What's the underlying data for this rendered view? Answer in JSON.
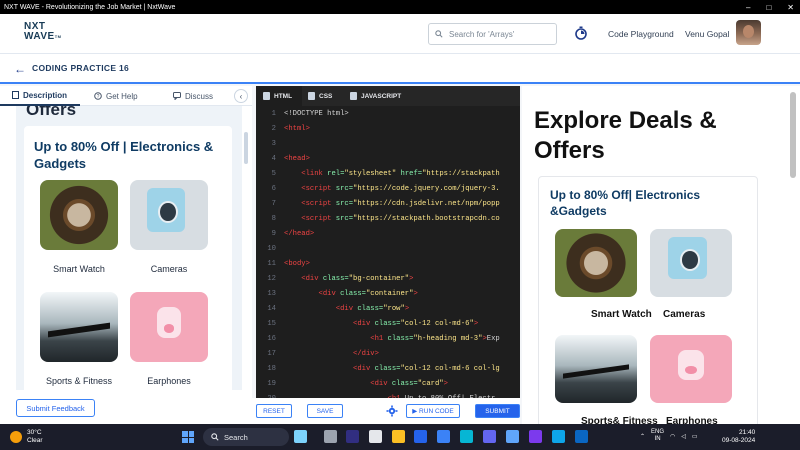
{
  "window": {
    "title": "NXT WAVE - Revolutionizing the Job Market | NxtWave",
    "controls": [
      "–",
      "□",
      "✕"
    ]
  },
  "header": {
    "logo_line1": "NXT",
    "logo_line2": "WAVE",
    "logo_tm": "TM",
    "search_placeholder": "Search for 'Arrays'",
    "playground_label": "Code Playground",
    "user_name": "Venu Gopal"
  },
  "subheader": {
    "back_icon": "←",
    "title": "CODING PRACTICE 16"
  },
  "left_panel": {
    "tabs": [
      {
        "label": "Description",
        "icon": "doc-icon"
      },
      {
        "label": "Get Help",
        "icon": "help-icon"
      },
      {
        "label": "Discuss",
        "icon": "chat-icon"
      }
    ],
    "collapse_icon": "‹",
    "preview": {
      "heading_cut": "Offers",
      "card_title": "Up to 80% Off | Electronics & Gadgets",
      "items": [
        {
          "label": "Smart Watch"
        },
        {
          "label": "Cameras"
        },
        {
          "label": "Sports & Fitness"
        },
        {
          "label": "Earphones"
        }
      ]
    },
    "feedback_button": "Submit Feedback"
  },
  "editor": {
    "tabs": [
      {
        "label": "HTML",
        "active": true
      },
      {
        "label": "CSS",
        "active": false
      },
      {
        "label": "JAVASCRIPT",
        "active": false
      }
    ],
    "lines": [
      {
        "n": "1",
        "parts": [
          [
            "p",
            "<!DOCTYPE html>"
          ]
        ]
      },
      {
        "n": "2",
        "parts": [
          [
            "t",
            "<html>"
          ]
        ]
      },
      {
        "n": "3",
        "parts": []
      },
      {
        "n": "4",
        "parts": [
          [
            "t",
            "<head>"
          ]
        ]
      },
      {
        "n": "5",
        "parts": [
          [
            "p",
            "    "
          ],
          [
            "t",
            "<link "
          ],
          [
            "a",
            "rel="
          ],
          [
            "s",
            "\"stylesheet\" "
          ],
          [
            "a",
            "href="
          ],
          [
            "s",
            "\"https://stackpath"
          ]
        ]
      },
      {
        "n": "6",
        "parts": [
          [
            "p",
            "    "
          ],
          [
            "t",
            "<script "
          ],
          [
            "a",
            "src="
          ],
          [
            "s",
            "\"https://code.jquery.com/jquery-3."
          ]
        ]
      },
      {
        "n": "7",
        "parts": [
          [
            "p",
            "    "
          ],
          [
            "t",
            "<script "
          ],
          [
            "a",
            "src="
          ],
          [
            "s",
            "\"https://cdn.jsdelivr.net/npm/popp"
          ]
        ]
      },
      {
        "n": "8",
        "parts": [
          [
            "p",
            "    "
          ],
          [
            "t",
            "<script "
          ],
          [
            "a",
            "src="
          ],
          [
            "s",
            "\"https://stackpath.bootstrapcdn.co"
          ]
        ]
      },
      {
        "n": "9",
        "parts": [
          [
            "t",
            "</head>"
          ]
        ]
      },
      {
        "n": "10",
        "parts": []
      },
      {
        "n": "11",
        "parts": [
          [
            "t",
            "<body>"
          ]
        ]
      },
      {
        "n": "12",
        "parts": [
          [
            "p",
            "    "
          ],
          [
            "t",
            "<div "
          ],
          [
            "a",
            "class="
          ],
          [
            "s",
            "\"bg-container\""
          ],
          [
            "t",
            ">"
          ]
        ]
      },
      {
        "n": "13",
        "parts": [
          [
            "p",
            "        "
          ],
          [
            "t",
            "<div "
          ],
          [
            "a",
            "class="
          ],
          [
            "s",
            "\"container\""
          ],
          [
            "t",
            ">"
          ]
        ]
      },
      {
        "n": "14",
        "parts": [
          [
            "p",
            "            "
          ],
          [
            "t",
            "<div "
          ],
          [
            "a",
            "class="
          ],
          [
            "s",
            "\"row\""
          ],
          [
            "t",
            ">"
          ]
        ]
      },
      {
        "n": "15",
        "parts": [
          [
            "p",
            "                "
          ],
          [
            "t",
            "<div "
          ],
          [
            "a",
            "class="
          ],
          [
            "s",
            "\"col-12 col-md-6\""
          ],
          [
            "t",
            ">"
          ]
        ]
      },
      {
        "n": "16",
        "parts": [
          [
            "p",
            "                    "
          ],
          [
            "t",
            "<h1 "
          ],
          [
            "a",
            "class="
          ],
          [
            "s",
            "\"h-heading md-3\""
          ],
          [
            "t",
            ">"
          ],
          [
            "p",
            "Exp"
          ]
        ]
      },
      {
        "n": "17",
        "parts": [
          [
            "p",
            "                "
          ],
          [
            "t",
            "</div>"
          ]
        ]
      },
      {
        "n": "18",
        "parts": [
          [
            "p",
            "                "
          ],
          [
            "t",
            "<div "
          ],
          [
            "a",
            "class="
          ],
          [
            "s",
            "\"col-12 col-md-6 col-lg"
          ]
        ]
      },
      {
        "n": "19",
        "parts": [
          [
            "p",
            "                    "
          ],
          [
            "t",
            "<div "
          ],
          [
            "a",
            "class="
          ],
          [
            "s",
            "\"card\""
          ],
          [
            "t",
            ">"
          ]
        ]
      },
      {
        "n": "20",
        "parts": [
          [
            "p",
            "                        "
          ],
          [
            "t",
            "<h1 "
          ],
          [
            "p",
            "Up to 80% Off| Electr"
          ]
        ]
      }
    ],
    "toolbar": {
      "reset": "RESET",
      "save": "SAVE",
      "run": "▶ RUN CODE",
      "submit": "SUBMIT"
    }
  },
  "output": {
    "heading": "Explore Deals & Offers",
    "card_title": "Up to 80% Off| Electronics &Gadgets",
    "items": [
      {
        "label": "Smart Watch"
      },
      {
        "label": "Cameras"
      },
      {
        "label": "Sports& Fitness"
      },
      {
        "label": "Earphones"
      }
    ]
  },
  "taskbar": {
    "temperature": "30°C",
    "weather": "Clear",
    "search": "Search",
    "lang1": "ENG",
    "lang2": "IN",
    "time": "21:40",
    "date": "09-08-2024"
  }
}
